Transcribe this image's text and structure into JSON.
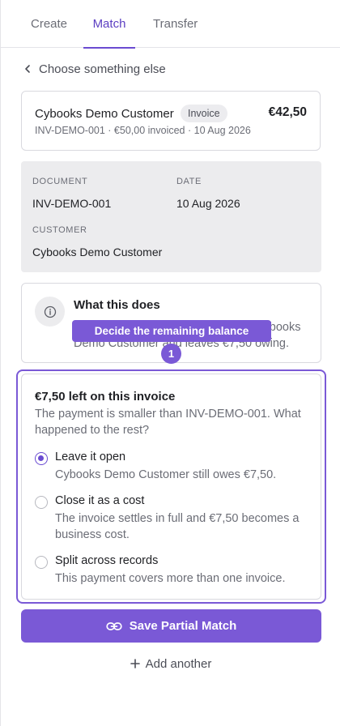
{
  "tabs": [
    {
      "label": "Create",
      "active": false
    },
    {
      "label": "Match",
      "active": true
    },
    {
      "label": "Transfer",
      "active": false
    }
  ],
  "back_link": {
    "label": "Choose something else",
    "icon": "chevron-left-icon"
  },
  "invoice_card": {
    "customer": "Cybooks Demo Customer",
    "badge": "Invoice",
    "amount": "€42,50",
    "meta": "INV-DEMO-001 · €50,00 invoiced · 10 Aug 2026"
  },
  "details": {
    "document_label": "DOCUMENT",
    "document_value": "INV-DEMO-001",
    "date_label": "DATE",
    "date_value": "10 Aug 2026",
    "customer_label": "CUSTOMER",
    "customer_value": "Cybooks Demo Customer"
  },
  "what_this_does": {
    "icon": "info-icon",
    "title": "What this does",
    "body": "Records a partial payment against Cybooks Demo Customer and leaves €7,50 owing."
  },
  "tooltip": {
    "text": "Decide the remaining balance",
    "step": "1"
  },
  "balance_card": {
    "title": "€7,50 left on this invoice",
    "description": "The payment is smaller than INV-DEMO-001. What happened to the rest?",
    "options": [
      {
        "label": "Leave it open",
        "description": "Cybooks Demo Customer still owes €7,50.",
        "selected": true
      },
      {
        "label": "Close it as a cost",
        "description": "The invoice settles in full and €7,50 becomes a business cost.",
        "selected": false
      },
      {
        "label": "Split across records",
        "description": "This payment covers more than one invoice.",
        "selected": false
      }
    ]
  },
  "save_button": {
    "label": "Save Partial Match",
    "icon": "link-icon"
  },
  "add_another": {
    "label": "Add another",
    "icon": "plus-icon"
  },
  "colors": {
    "accent": "#7a59d6",
    "panel": "#ececee",
    "border": "#d9d9df"
  }
}
